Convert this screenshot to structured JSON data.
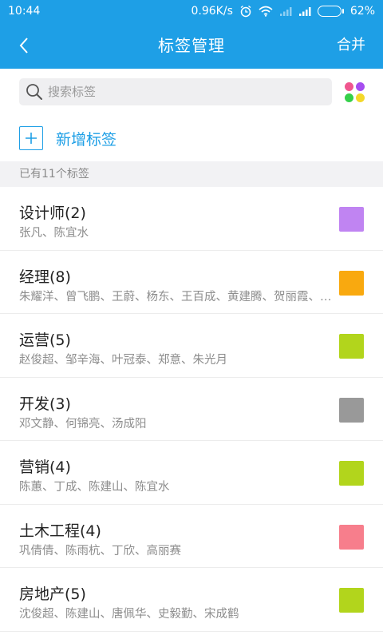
{
  "status_bar": {
    "time": "10:44",
    "speed": "0.96K/s",
    "battery": "62%",
    "battery_level": 0.62,
    "icons": [
      "alarm-icon",
      "wifi-icon",
      "signal-icon",
      "signal-icon",
      "battery-icon"
    ]
  },
  "header": {
    "back_icon": "chevron-left-icon",
    "title": "标签管理",
    "action": "合并"
  },
  "search": {
    "placeholder": "搜索标签",
    "value": "",
    "icon": "search-icon"
  },
  "palette": {
    "icon": "color-palette-icon",
    "colors": [
      "#f0568f",
      "#a64df0",
      "#35d04a",
      "#f4d82a"
    ]
  },
  "add_tag": {
    "icon": "plus-icon",
    "label": "新增标签"
  },
  "section": {
    "count_label": "已有11个标签"
  },
  "tags": [
    {
      "name": "设计师(2)",
      "members": "张凡、陈宜水",
      "color": "#c084f2"
    },
    {
      "name": "经理(8)",
      "members": "朱耀洋、曾飞鹏、王蔚、杨东、王百成、黄建腾、贺丽霞、陈宜水",
      "color": "#f9a90f"
    },
    {
      "name": "运营(5)",
      "members": "赵俊超、邹辛海、叶冠泰、郑意、朱光月",
      "color": "#b2d51c"
    },
    {
      "name": "开发(3)",
      "members": "邓文静、何锦亮、汤成阳",
      "color": "#999999"
    },
    {
      "name": "营销(4)",
      "members": "陈蕙、丁成、陈建山、陈宜水",
      "color": "#b2d51c"
    },
    {
      "name": "土木工程(4)",
      "members": "巩倩倩、陈雨杭、丁欣、高丽赛",
      "color": "#f77e8c"
    },
    {
      "name": "房地产(5)",
      "members": "沈俊超、陈建山、唐佩华、史毅勤、宋成鹤",
      "color": "#b2d51c"
    }
  ]
}
